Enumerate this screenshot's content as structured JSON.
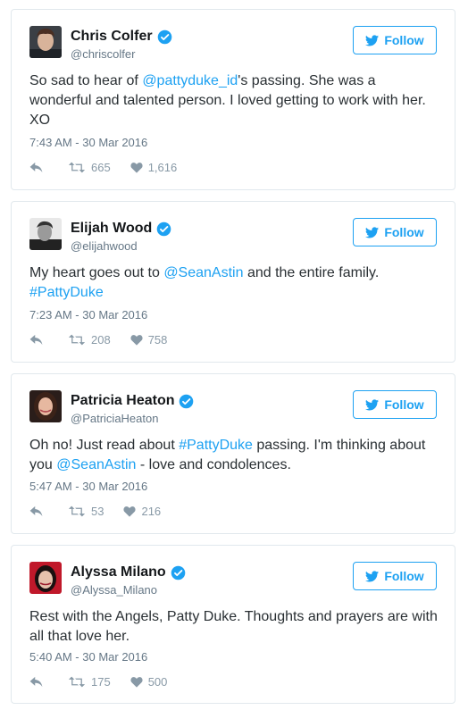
{
  "follow_label": "Follow",
  "tweets": [
    {
      "name": "Chris Colfer",
      "handle": "@chriscolfer",
      "text_before": "So sad to hear of ",
      "mention": "@pattyduke_id",
      "text_after": "'s passing. She was a wonderful and talented person. I loved getting to work with her. XO",
      "timestamp": "7:43 AM - 30 Mar 2016",
      "retweets": "665",
      "likes": "1,616"
    },
    {
      "name": "Elijah Wood",
      "handle": "@elijahwood",
      "text_before": "My heart goes out to ",
      "mention": "@SeanAstin",
      "text_middle": " and the entire family. ",
      "hashtag": "#PattyDuke",
      "timestamp": "7:23 AM - 30 Mar 2016",
      "retweets": "208",
      "likes": "758"
    },
    {
      "name": "Patricia Heaton",
      "handle": "@PatriciaHeaton",
      "text_before": "Oh no! Just read about ",
      "hashtag": "#PattyDuke",
      "text_middle": " passing. I'm thinking about you ",
      "mention": "@SeanAstin",
      "text_after": " - love and condolences.",
      "timestamp": "5:47 AM - 30 Mar 2016",
      "retweets": "53",
      "likes": "216"
    },
    {
      "name": "Alyssa Milano",
      "handle": "@Alyssa_Milano",
      "text_before": "Rest with the Angels, Patty Duke. Thoughts and prayers are with all that love her.",
      "timestamp": "5:40 AM - 30 Mar 2016",
      "retweets": "175",
      "likes": "500"
    }
  ],
  "icons": {
    "verified": "verified-badge-icon",
    "bird": "twitter-bird-icon",
    "reply": "reply-icon",
    "retweet": "retweet-icon",
    "like": "heart-icon"
  },
  "colors": {
    "accent": "#1da1f2",
    "secondary_text": "#657786",
    "border": "#e1e8ed"
  }
}
